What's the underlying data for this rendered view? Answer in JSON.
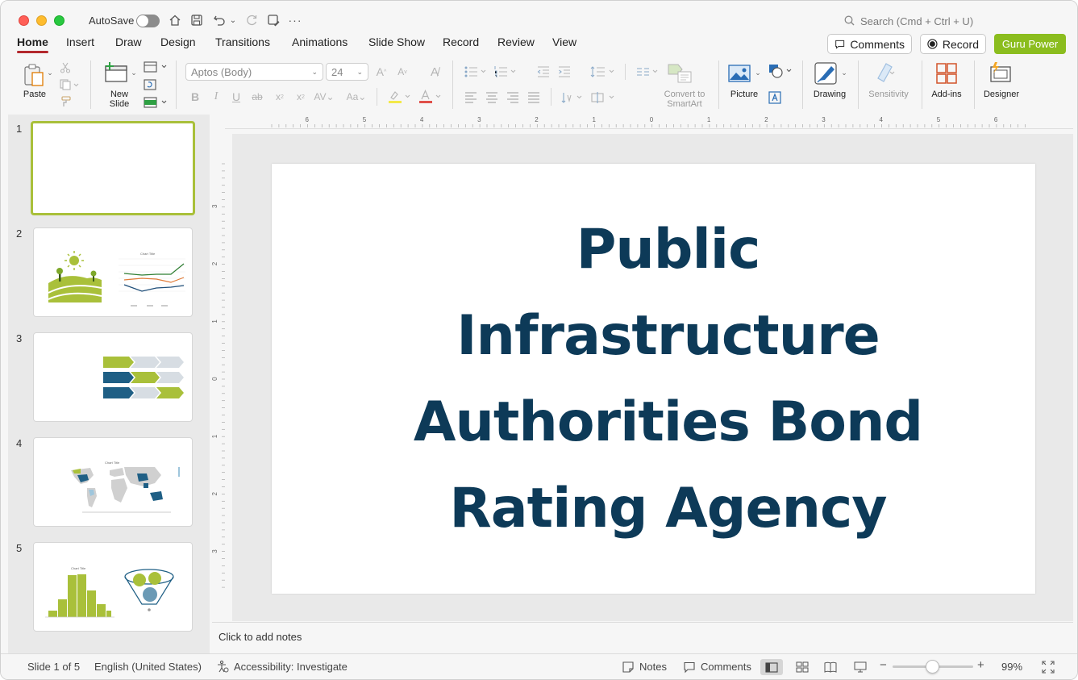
{
  "titlebar": {
    "autosave_label": "AutoSave",
    "search_placeholder": "Search (Cmd + Ctrl + U)"
  },
  "tabs": [
    "Home",
    "Insert",
    "Draw",
    "Design",
    "Transitions",
    "Animations",
    "Slide Show",
    "Record",
    "Review",
    "View"
  ],
  "actions": {
    "comments_label": "Comments",
    "record_label": "Record",
    "guru_label": "Guru Power"
  },
  "ribbon": {
    "paste": "Paste",
    "new_slide_line1": "New",
    "new_slide_line2": "Slide",
    "font_name": "Aptos (Body)",
    "font_size": "24",
    "convert_line1": "Convert to",
    "convert_line2": "SmartArt",
    "picture": "Picture",
    "drawing": "Drawing",
    "sensitivity": "Sensitivity",
    "addins": "Add-ins",
    "designer": "Designer"
  },
  "slides": {
    "numbers": [
      "1",
      "2",
      "3",
      "4",
      "5"
    ],
    "thumb4_title": "Chart Title",
    "thumb5_title": "Chart Title"
  },
  "slide": {
    "title_line1": "Public",
    "title_line2": "Infrastructure",
    "title_line3": "Authorities Bond",
    "title_line4": "Rating Agency"
  },
  "notes_placeholder": "Click to add notes",
  "status": {
    "slide_counter": "Slide 1 of 5",
    "language": "English (United States)",
    "accessibility": "Accessibility: Investigate",
    "notes": "Notes",
    "comments": "Comments",
    "zoom_value": "99%"
  },
  "colors": {
    "accent_tab": "#b3282d",
    "guru_green": "#8bbd1e",
    "title_navy": "#0d3a58",
    "thumb_green": "#a9c03a"
  },
  "ruler_h_ticks": [
    "6",
    "5",
    "4",
    "3",
    "2",
    "1",
    "0",
    "1",
    "2",
    "3",
    "4",
    "5",
    "6"
  ],
  "ruler_v_ticks": [
    "3",
    "2",
    "1",
    "0",
    "1",
    "2",
    "3"
  ]
}
